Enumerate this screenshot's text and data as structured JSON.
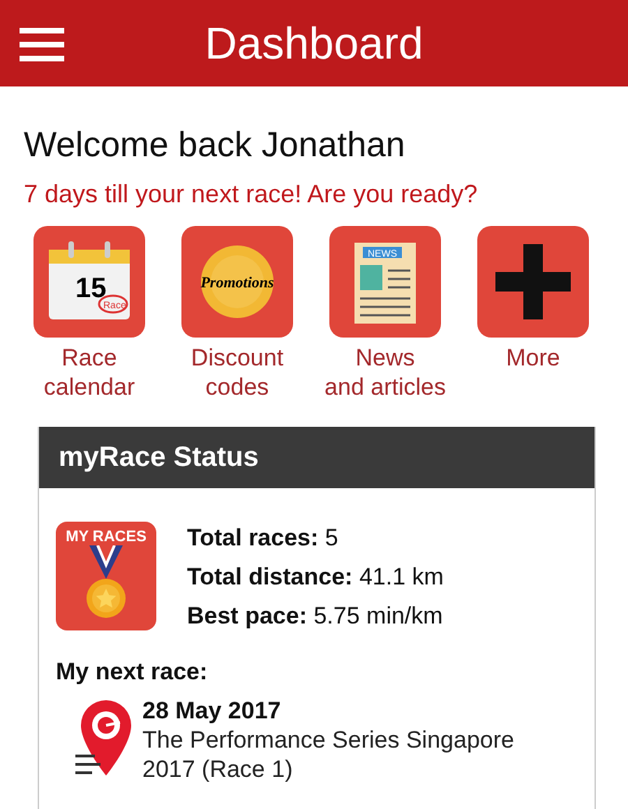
{
  "header": {
    "title": "Dashboard"
  },
  "welcome": {
    "title": "Welcome back Jonathan",
    "subtitle": "7 days till your next race! Are you ready?"
  },
  "tiles": [
    {
      "kind": "calendar",
      "label": "Race calendar",
      "icon_text": "15",
      "stamp_text": "Race"
    },
    {
      "kind": "promotions",
      "label": "Discount codes",
      "icon_text": "Promotions"
    },
    {
      "kind": "news",
      "label": "News and articles",
      "icon_text": "NEWS"
    },
    {
      "kind": "more",
      "label": "More"
    }
  ],
  "status_card": {
    "title": "myRace Status",
    "badge_text": "MY RACES",
    "stats": [
      {
        "label": "Total races:",
        "value": "5"
      },
      {
        "label": "Total distance:",
        "value": "41.1 km"
      },
      {
        "label": "Best pace:",
        "value": "5.75 min/km"
      }
    ],
    "next_race_heading": "My next race:",
    "next_race": {
      "date": "28 May 2017",
      "name": "The Performance Series Singapore 2017 (Race 1)"
    }
  }
}
